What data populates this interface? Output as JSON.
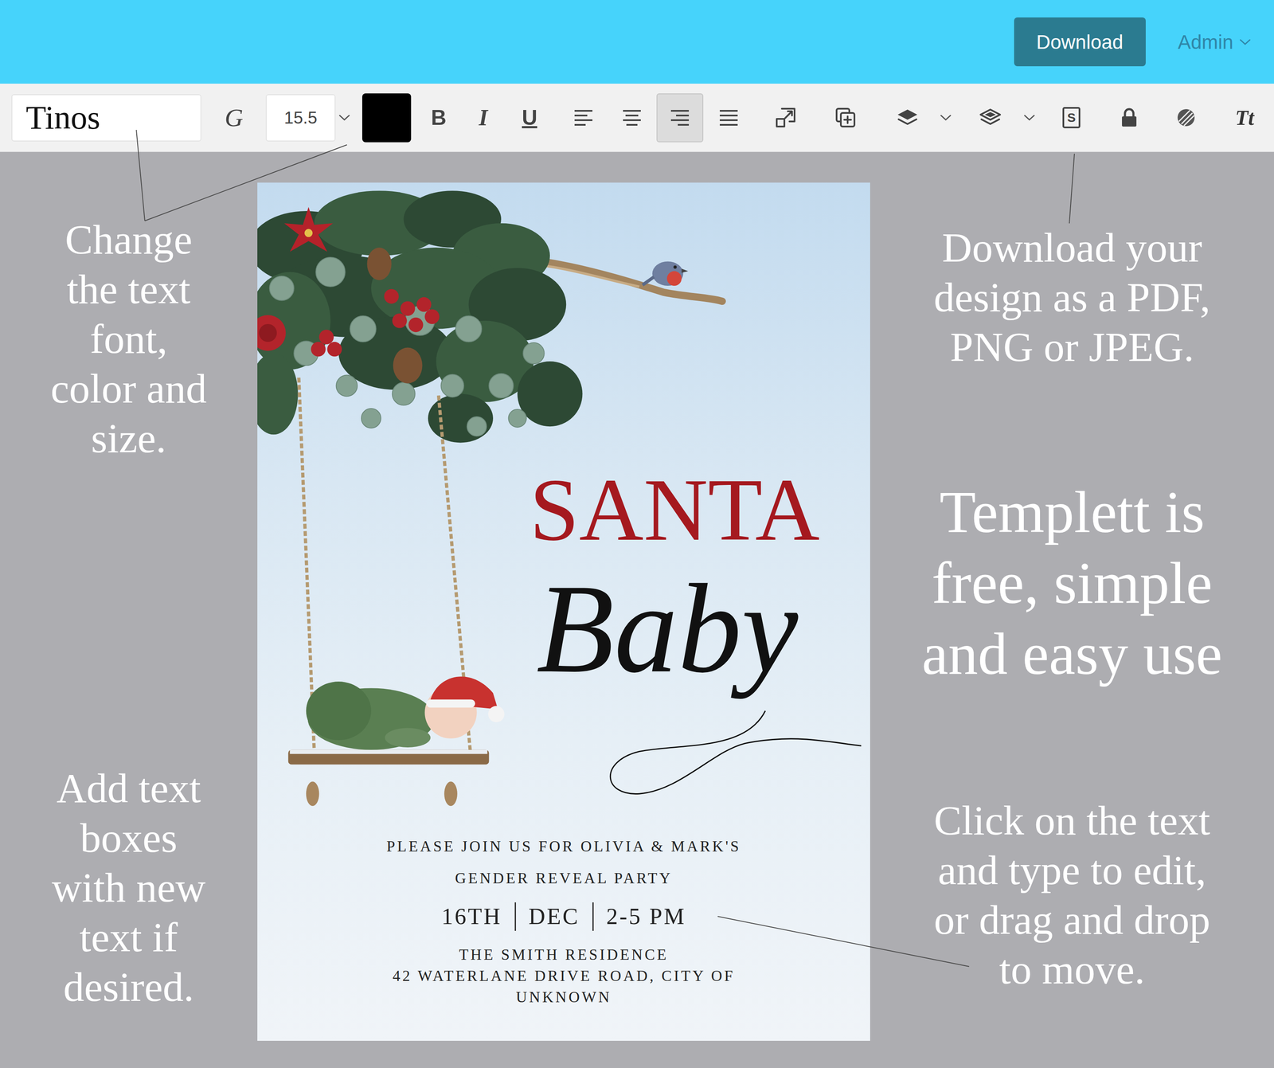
{
  "header": {
    "download_button": "Download",
    "account_menu": "Admin"
  },
  "toolbar": {
    "font_family": "Tinos",
    "font_style_button": "G",
    "font_size": "15.5",
    "text_color": "#000000",
    "bold_button": "B",
    "italic_button": "I",
    "underline_button": "U",
    "alignments": [
      {
        "kind": "left",
        "selected": false
      },
      {
        "kind": "center",
        "selected": false
      },
      {
        "kind": "right",
        "selected": true
      },
      {
        "kind": "justify",
        "selected": false
      }
    ],
    "style_button": "S",
    "text_size_button": "Tt"
  },
  "annotations": {
    "font_tip": [
      "Change",
      "the text",
      "font,",
      "color and",
      "size."
    ],
    "textbox_tip": [
      "Add text",
      "boxes",
      "with new",
      "text if",
      "desired."
    ],
    "download_tip": [
      "Download your",
      "design as a PDF,",
      "PNG or JPEG."
    ],
    "promo": [
      "Templett is",
      "free, simple",
      "and easy use"
    ],
    "edit_tip": [
      "Click on the text",
      "and type to edit,",
      "or drag and drop",
      "to move."
    ]
  },
  "invitation": {
    "title": "SANTA",
    "subtitle": "Baby",
    "lines": [
      "PLEASE JOIN US FOR OLIVIA & MARK'S",
      "GENDER REVEAL PARTY"
    ],
    "date": [
      "16TH",
      "DEC",
      "2-5 PM"
    ],
    "address": [
      "THE SMITH RESIDENCE",
      "42 WATERLANE DRIVE ROAD, CITY OF",
      "UNKNOWN"
    ]
  }
}
